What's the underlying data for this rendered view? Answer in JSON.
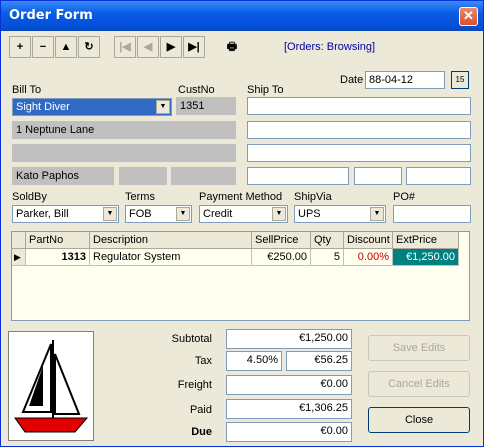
{
  "window": {
    "title": "Order Form"
  },
  "toolbar": {
    "buttons": [
      {
        "name": "add-record-button",
        "glyph": "+"
      },
      {
        "name": "delete-record-button",
        "glyph": "−"
      },
      {
        "name": "post-button",
        "glyph": "▲"
      },
      {
        "name": "refresh-button",
        "glyph": "↻"
      },
      {
        "name": "first-record-button",
        "glyph": "|◀"
      },
      {
        "name": "prior-record-button",
        "glyph": "◀"
      },
      {
        "name": "next-record-button",
        "glyph": "▶"
      },
      {
        "name": "last-record-button",
        "glyph": "▶|"
      },
      {
        "name": "print-button",
        "glyph": "🖶"
      }
    ],
    "status": "[Orders: Browsing]"
  },
  "labels": {
    "bill_to": "Bill To",
    "cust_no": "CustNo",
    "ship_to": "Ship To",
    "date": "Date",
    "sold_by": "SoldBy",
    "terms": "Terms",
    "payment_method": "Payment Method",
    "ship_via": "ShipVia",
    "po": "PO#"
  },
  "bill_to": {
    "customer": "Sight Diver",
    "cust_no": "1351",
    "address1": "1 Neptune Lane",
    "address2": "",
    "city": "Kato Paphos",
    "state": "",
    "zip": ""
  },
  "ship_to": {
    "line1": "",
    "line2": "",
    "line3": "",
    "city": "",
    "state": "",
    "zip": ""
  },
  "date": {
    "value": "88-04-12",
    "calendar_glyph": "15"
  },
  "sold_by": "Parker, Bill",
  "terms": "FOB",
  "payment_method": "Credit",
  "ship_via": "UPS",
  "po": "",
  "grid": {
    "columns": [
      "PartNo",
      "Description",
      "SellPrice",
      "Qty",
      "Discount",
      "ExtPrice"
    ],
    "rows": [
      {
        "partno": "1313",
        "description": "Regulator System",
        "sellprice": "€250.00",
        "qty": "5",
        "discount": "0.00%",
        "extprice": "€1,250.00"
      }
    ],
    "row_indicator": "▶"
  },
  "summary": {
    "subtotal_label": "Subtotal",
    "subtotal": "€1,250.00",
    "tax_label": "Tax",
    "tax_rate": "4.50%",
    "tax_amount": "€56.25",
    "freight_label": "Freight",
    "freight": "€0.00",
    "paid_label": "Paid",
    "paid": "€1,306.25",
    "due_label": "Due",
    "due": "€0.00"
  },
  "buttons": {
    "save": "Save Edits",
    "cancel": "Cancel Edits",
    "close": "Close"
  },
  "colors": {
    "titlebar": "#0a5ce6",
    "extprice_bg": "#008080",
    "discount_text": "#c00000",
    "status_text": "#0000a0"
  }
}
